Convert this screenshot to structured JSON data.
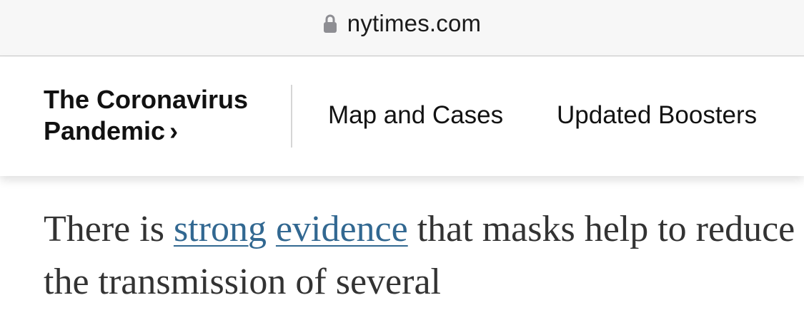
{
  "browser": {
    "url": "nytimes.com",
    "lock_icon": "lock-icon"
  },
  "nav": {
    "section_title_line1": "The Coronavirus",
    "section_title_line2": "Pandemic",
    "section_chevron": "›",
    "links": [
      {
        "label": "Map and Cases"
      },
      {
        "label": "Updated Boosters"
      }
    ]
  },
  "article": {
    "text_start": "There is ",
    "link1": "strong",
    "space": " ",
    "link2": "evidence",
    "text_end": " that masks help to reduce the transmission of several",
    "link_color": "#326891"
  }
}
